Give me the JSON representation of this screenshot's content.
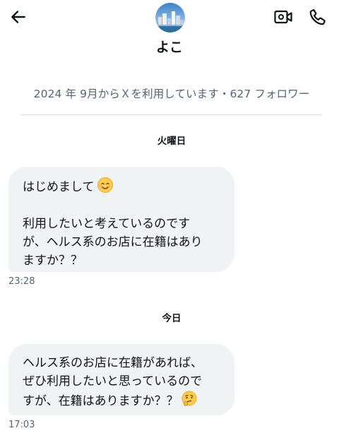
{
  "header": {
    "back_icon": "arrow-left-icon",
    "avatar_icon": "city-skyline-avatar",
    "video_icon": "video-call-icon",
    "phone_icon": "phone-icon",
    "name": "よこ",
    "profile_info": "2024 年 9月からＸを利用しています・627 フォロワー"
  },
  "conversation": {
    "days": [
      {
        "label": "火曜日",
        "message": {
          "paragraph1": "はじめまして",
          "paragraph1_emoji": "smiling-face-emoji",
          "lines": [
            "利用したいと考えているのです",
            "が、ヘルス系のお店に在籍はあり",
            "ますか？？"
          ],
          "time": "23:28"
        }
      },
      {
        "label": "今日",
        "message": {
          "lines": [
            "ヘルス系のお店に在籍があれば、",
            "ぜひ利用したいと思っているので",
            "すが、在籍はありますか？？"
          ],
          "trailing_emoji": "thinking-face-emoji",
          "time": "17:03"
        }
      }
    ]
  },
  "colors": {
    "bubble_bg": "#eff3f4",
    "secondary_text": "#536471",
    "divider": "#cfd9de",
    "primary_text": "#0f1419"
  }
}
